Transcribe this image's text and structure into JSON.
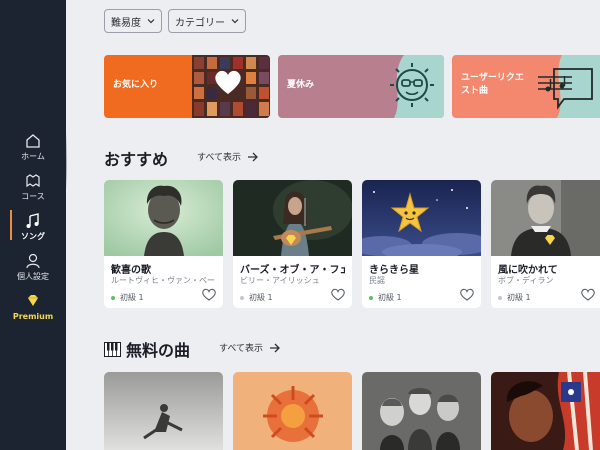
{
  "sidebar": {
    "items": [
      {
        "label": "ホーム",
        "icon": "home-icon"
      },
      {
        "label": "コース",
        "icon": "course-icon"
      },
      {
        "label": "ソング",
        "icon": "music-notes-icon"
      },
      {
        "label": "個人設定",
        "icon": "user-icon"
      },
      {
        "label": "Premium",
        "icon": "diamond-icon"
      }
    ],
    "active": "ソング"
  },
  "filters": {
    "difficulty": "難易度",
    "category": "カテゴリー"
  },
  "banners": [
    {
      "label": "お気に入り",
      "color": "#f06a1f"
    },
    {
      "label": "夏休み",
      "color": "#b87f8e"
    },
    {
      "label_line1": "ユーザーリクエ",
      "label_line2": "スト曲",
      "color": "#f3886e"
    }
  ],
  "recommended": {
    "title": "おすすめ",
    "see_all": "すべて表示",
    "cards": [
      {
        "title": "歓喜の歌",
        "artist": "ルートヴィヒ・ヴァン・ベートーヴェン",
        "level": "初級 1",
        "level_color": "#5cc06a"
      },
      {
        "title": "バーズ・オブ・ア・フェザー",
        "artist": "ビリー・アイリッシュ",
        "level": "初級 1",
        "level_color": "#c4c7cc"
      },
      {
        "title": "きらきら星",
        "artist": "民謡",
        "level": "初級 1",
        "level_color": "#5cc06a"
      },
      {
        "title": "風に吹かれて",
        "artist": "ボブ・ディラン",
        "level": "初級 1",
        "level_color": "#c4c7cc"
      }
    ]
  },
  "free_songs": {
    "title": "無料の曲",
    "see_all": "すべて表示"
  },
  "colors": {
    "sidebar_bg": "#1d2431",
    "premium_accent": "#f5d84a",
    "active_marker": "#f08a3c",
    "page_bg": "#eceef1"
  }
}
